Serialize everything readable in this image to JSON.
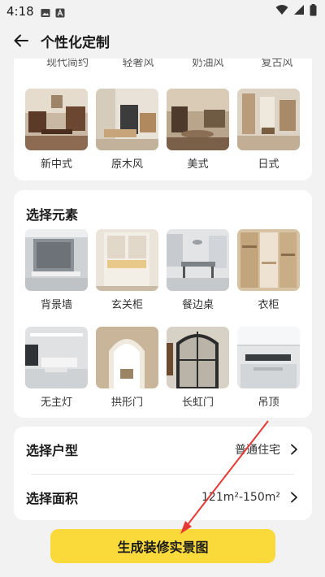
{
  "status_bar": {
    "time": "4:18"
  },
  "header": {
    "title": "个性化定制"
  },
  "styles": {
    "partial_labels": [
      "现代简约",
      "轻奢风",
      "奶油风",
      "复古风"
    ],
    "items": [
      {
        "label": "新中式"
      },
      {
        "label": "原木风"
      },
      {
        "label": "美式"
      },
      {
        "label": "日式"
      }
    ]
  },
  "elements": {
    "title": "选择元素",
    "items": [
      {
        "label": "背景墙"
      },
      {
        "label": "玄关柜"
      },
      {
        "label": "餐边桌"
      },
      {
        "label": "衣柜"
      },
      {
        "label": "无主灯"
      },
      {
        "label": "拱形门"
      },
      {
        "label": "长虹门"
      },
      {
        "label": "吊顶"
      }
    ]
  },
  "options": {
    "house_type": {
      "label": "选择户型",
      "value": "普通住宅"
    },
    "area": {
      "label": "选择面积",
      "value": "121m²-150m²"
    }
  },
  "cta": {
    "label": "生成装修实景图"
  },
  "colors": {
    "accent": "#fad93b",
    "annotation_arrow": "#e53935"
  }
}
